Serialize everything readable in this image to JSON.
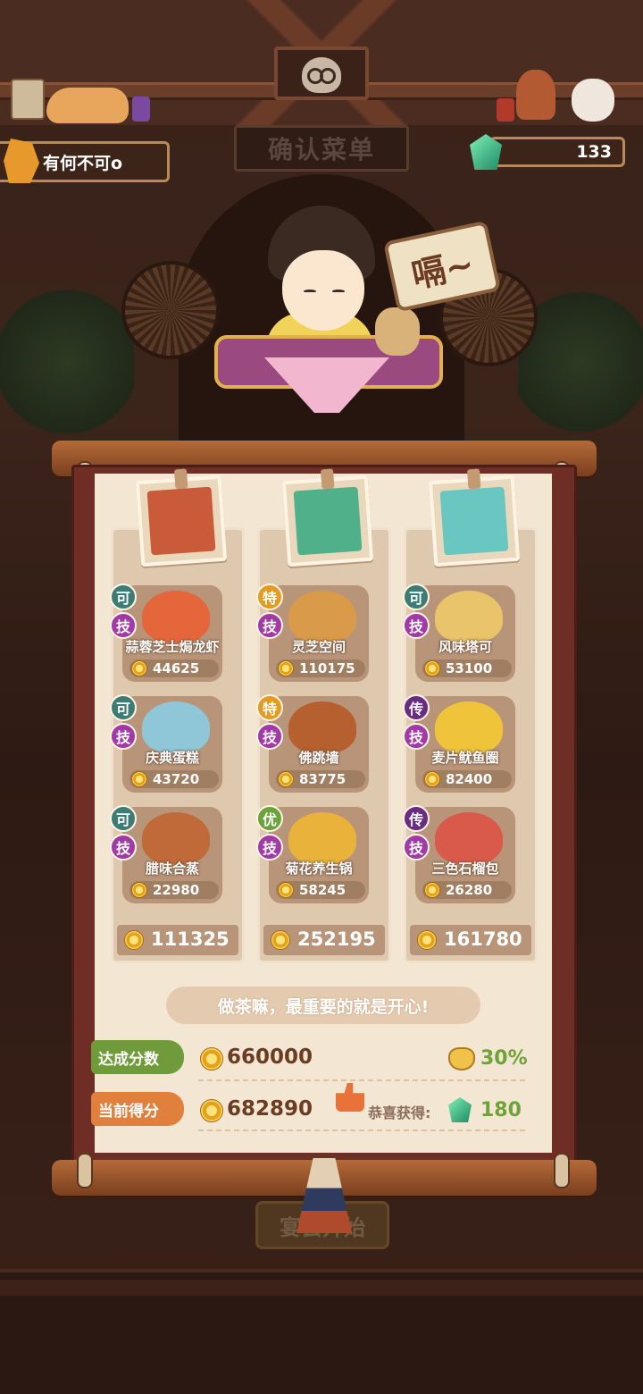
{
  "header": {
    "sign_text": "确认菜单",
    "player_name": "有何不可o",
    "gems": "133"
  },
  "character": {
    "speech": "嗝~"
  },
  "columns": [
    {
      "portrait_color": "#c95a3a",
      "dishes": [
        {
          "rank": "可",
          "rank_class": "r-ke",
          "skill": "技",
          "name": "蒜蓉芝士焗龙虾",
          "score": "44625",
          "plate_color": "#e4663a"
        },
        {
          "rank": "可",
          "rank_class": "r-ke",
          "skill": "技",
          "name": "庆典蛋糕",
          "score": "43720",
          "plate_color": "#8fc6d8"
        },
        {
          "rank": "可",
          "rank_class": "r-ke",
          "skill": "技",
          "name": "腊味合蒸",
          "score": "22980",
          "plate_color": "#c06a3a"
        }
      ],
      "total": "111325"
    },
    {
      "portrait_color": "#4fb08a",
      "dishes": [
        {
          "rank": "特",
          "rank_class": "r-te",
          "skill": "技",
          "name": "灵芝空间",
          "score": "110175",
          "plate_color": "#d99a4a"
        },
        {
          "rank": "特",
          "rank_class": "r-te",
          "skill": "技",
          "name": "佛跳墙",
          "score": "83775",
          "plate_color": "#b5602e"
        },
        {
          "rank": "优",
          "rank_class": "r-you",
          "skill": "技",
          "name": "菊花养生锅",
          "score": "58245",
          "plate_color": "#e9b23a"
        }
      ],
      "total": "252195"
    },
    {
      "portrait_color": "#6ac6c0",
      "dishes": [
        {
          "rank": "可",
          "rank_class": "r-ke",
          "skill": "技",
          "name": "风味塔可",
          "score": "53100",
          "plate_color": "#e9c46a"
        },
        {
          "rank": "传",
          "rank_class": "r-chuan",
          "skill": "技",
          "name": "麦片鱿鱼圈",
          "score": "82400",
          "plate_color": "#f0c43a"
        },
        {
          "rank": "传",
          "rank_class": "r-chuan",
          "skill": "技",
          "name": "三色石榴包",
          "score": "26280",
          "plate_color": "#d95a4a"
        }
      ],
      "total": "161780"
    }
  ],
  "quote": "做茶嘛，最重要的就是开心!",
  "target": {
    "label": "达成分数",
    "value": "660000",
    "bonus": "30%"
  },
  "current": {
    "label": "当前得分",
    "value": "682890",
    "congrats_label": "恭喜获得:",
    "reward": "180"
  },
  "start_button": "宴会开始"
}
